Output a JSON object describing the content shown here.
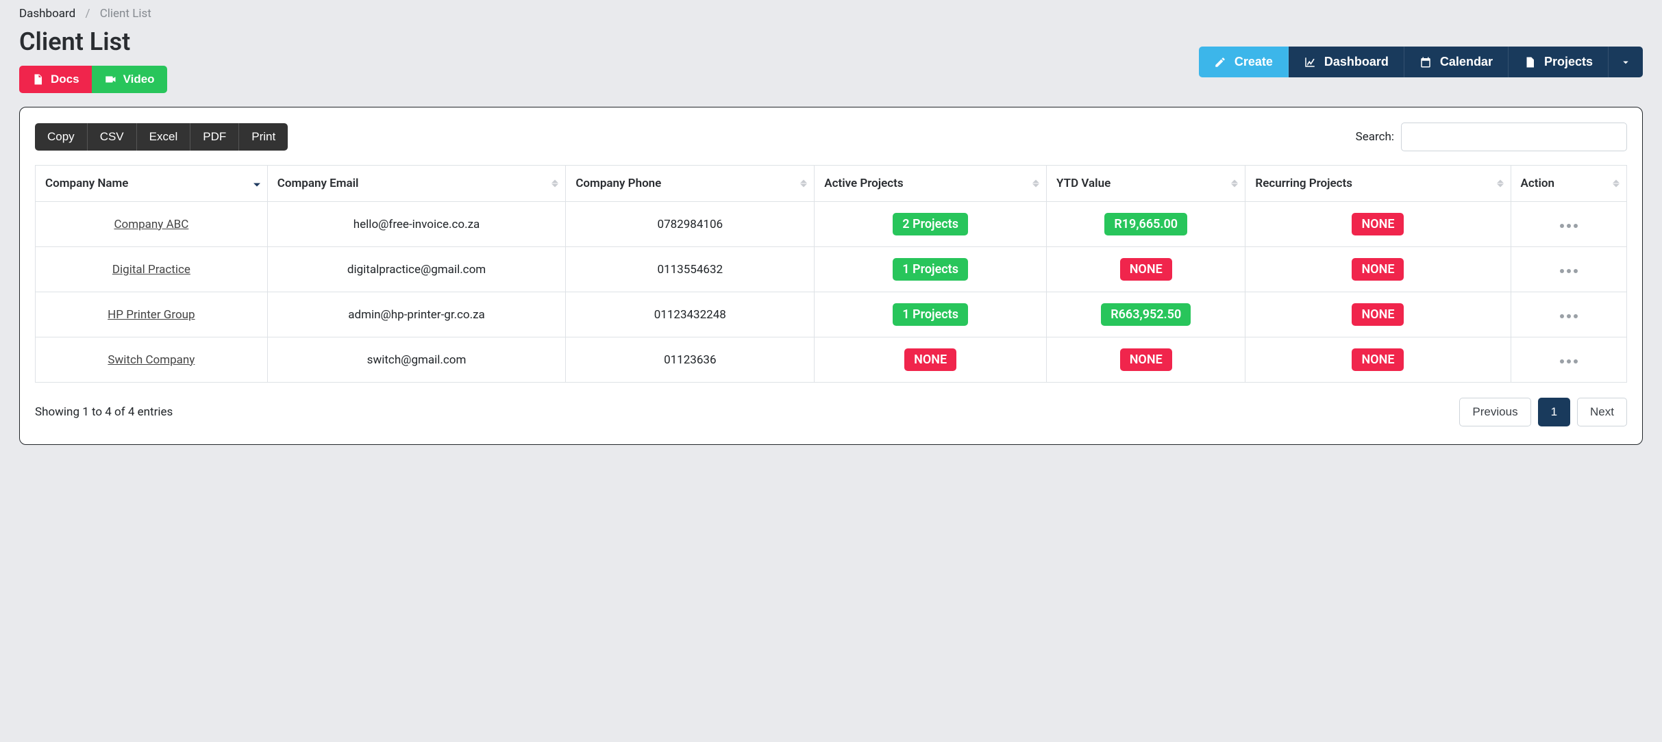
{
  "breadcrumb": {
    "root": "Dashboard",
    "current": "Client List"
  },
  "page_title": "Client List",
  "left_buttons": {
    "docs": "Docs",
    "video": "Video"
  },
  "nav_buttons": {
    "create": "Create",
    "dashboard": "Dashboard",
    "calendar": "Calendar",
    "projects": "Projects"
  },
  "export_buttons": [
    "Copy",
    "CSV",
    "Excel",
    "PDF",
    "Print"
  ],
  "search": {
    "label": "Search:",
    "value": ""
  },
  "columns": [
    "Company Name",
    "Company Email",
    "Company Phone",
    "Active Projects",
    "YTD Value",
    "Recurring Projects",
    "Action"
  ],
  "rows": [
    {
      "name": "Company ABC",
      "email": "hello@free-invoice.co.za",
      "phone": "0782984106",
      "active": {
        "text": "2 Projects",
        "type": "green"
      },
      "ytd": {
        "text": "R19,665.00",
        "type": "green"
      },
      "recur": {
        "text": "NONE",
        "type": "red"
      }
    },
    {
      "name": "Digital Practice",
      "email": "digitalpractice@gmail.com",
      "phone": "0113554632",
      "active": {
        "text": "1 Projects",
        "type": "green"
      },
      "ytd": {
        "text": "NONE",
        "type": "red"
      },
      "recur": {
        "text": "NONE",
        "type": "red"
      }
    },
    {
      "name": "HP Printer Group",
      "email": "admin@hp-printer-gr.co.za",
      "phone": "01123432248",
      "active": {
        "text": "1 Projects",
        "type": "green"
      },
      "ytd": {
        "text": "R663,952.50",
        "type": "green"
      },
      "recur": {
        "text": "NONE",
        "type": "red"
      }
    },
    {
      "name": "Switch Company",
      "email": "switch@gmail.com",
      "phone": "01123636",
      "active": {
        "text": "NONE",
        "type": "red"
      },
      "ytd": {
        "text": "NONE",
        "type": "red"
      },
      "recur": {
        "text": "NONE",
        "type": "red"
      }
    }
  ],
  "footer": {
    "summary": "Showing 1 to 4 of 4 entries",
    "previous": "Previous",
    "page": "1",
    "next": "Next"
  }
}
